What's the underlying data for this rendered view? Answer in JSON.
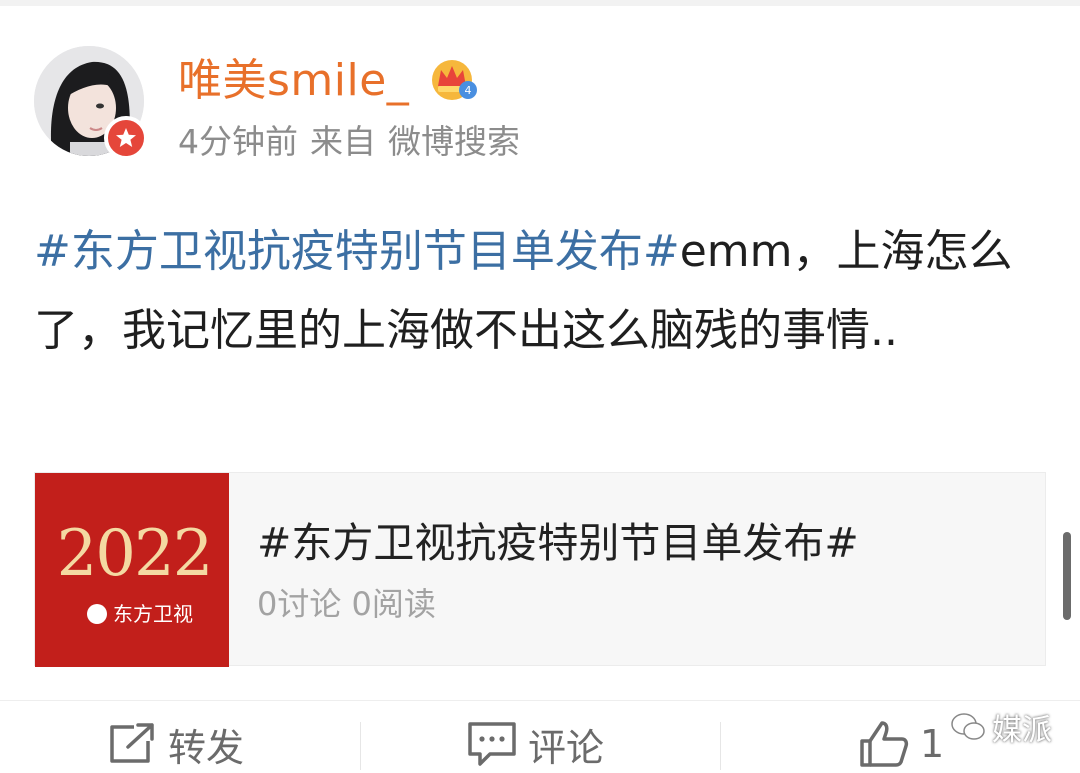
{
  "user": {
    "name": "唯美smile_",
    "time": "4分钟前",
    "source_prefix": "来自",
    "source": "微博搜索",
    "level_badge": "crown-level-icon"
  },
  "post": {
    "hashtag": "#东方卫视抗疫特别节目单发布#",
    "text": "emm，上海怎么了，我记忆里的上海做不出这么脑残的事情.."
  },
  "card": {
    "image_year": "2022",
    "image_logo": "东方卫视",
    "title": "#东方卫视抗疫特别节目单发布#",
    "stats": "0讨论 0阅读"
  },
  "actions": {
    "repost": "转发",
    "comment": "评论",
    "like_count": "1"
  },
  "watermark": "媒派",
  "colors": {
    "username": "#e8702a",
    "hashtag": "#3c6fa3",
    "card_red": "#c21f1b",
    "muted": "#8c8c8c"
  }
}
